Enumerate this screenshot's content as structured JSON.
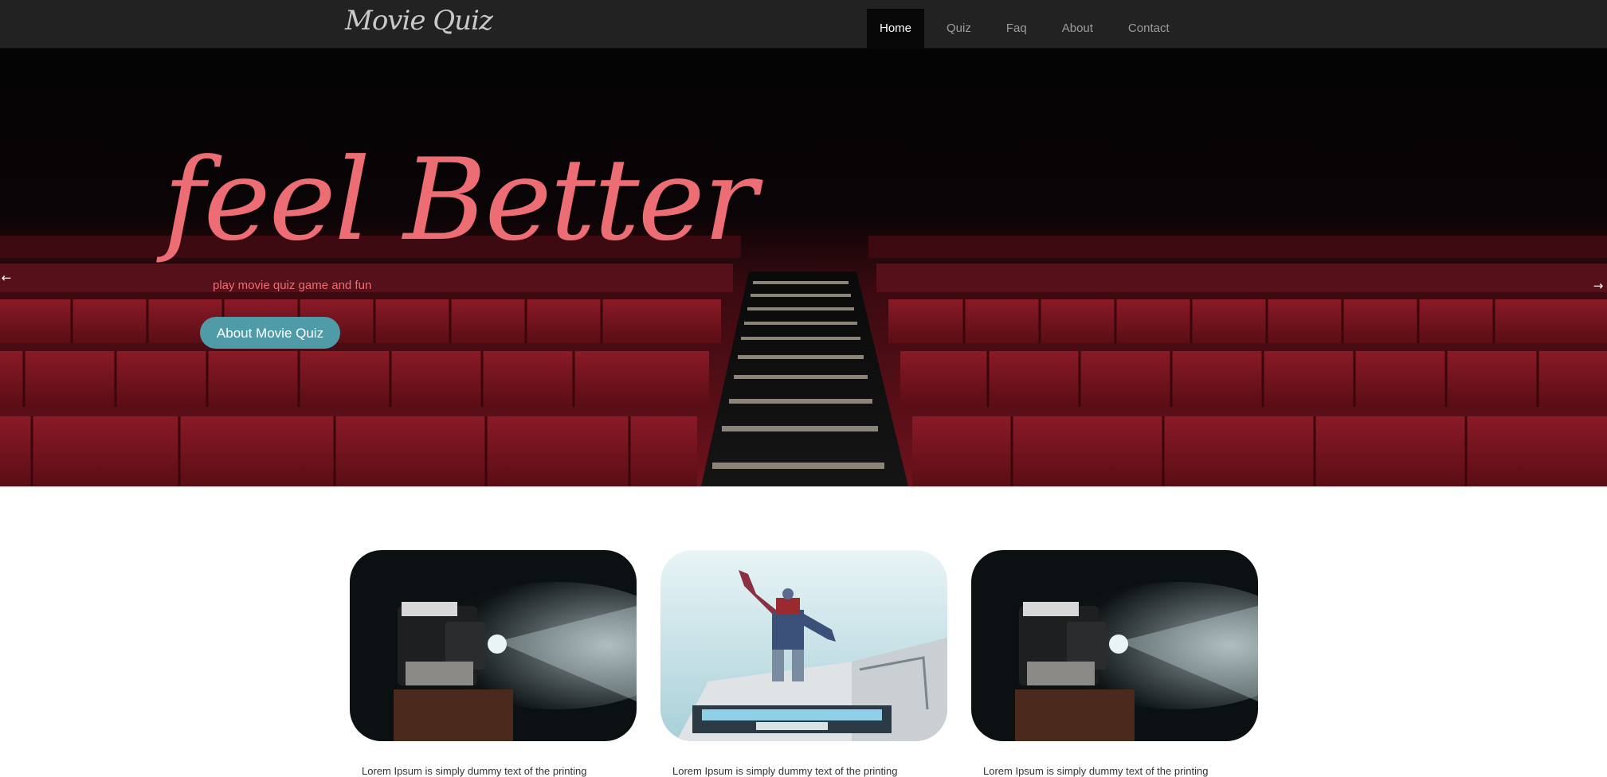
{
  "brand": "Movie Quiz",
  "nav": {
    "items": [
      "Home",
      "Quiz",
      "Faq",
      "About",
      "Contact"
    ],
    "active": "Home"
  },
  "hero": {
    "title": "feel Better",
    "subtitle": "play movie quiz game and fun",
    "button_label": "About Movie Quiz",
    "prev_icon": "arrow-left-icon",
    "next_icon": "arrow-right-icon"
  },
  "cards": [
    {
      "image": "film-projector",
      "text": "Lorem Ipsum is simply dummy text of the printing"
    },
    {
      "image": "transformers-statue",
      "text": "Lorem Ipsum is simply dummy text of the printing"
    },
    {
      "image": "film-projector",
      "text": "Lorem Ipsum is simply dummy text of the printing"
    }
  ],
  "colors": {
    "nav_bg": "#222222",
    "accent_pink": "#ec6d74",
    "button_teal": "#4f9ca8",
    "seat_red": "#7a1420"
  }
}
